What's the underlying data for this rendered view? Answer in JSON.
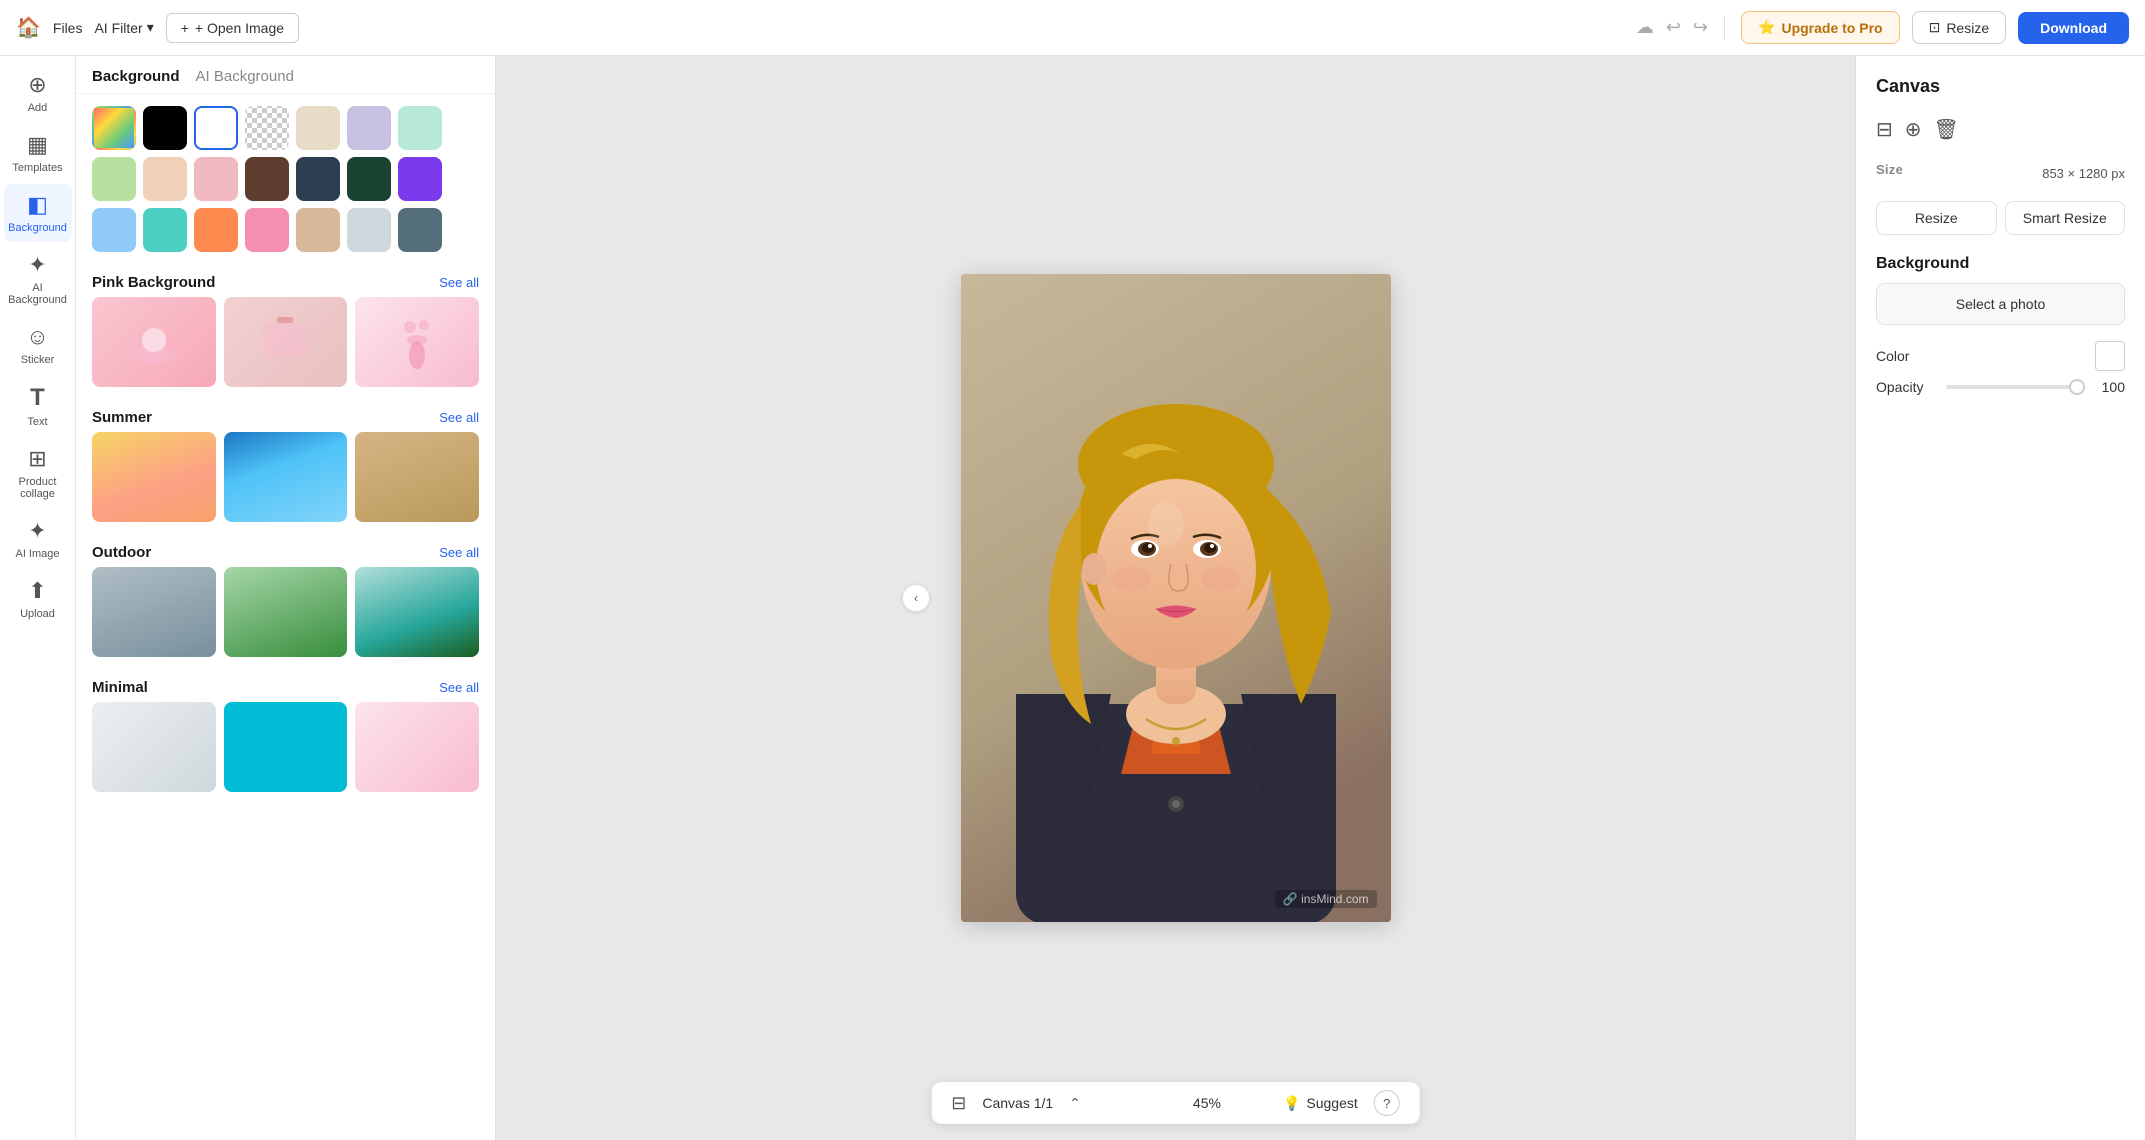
{
  "topbar": {
    "home_icon": "🏠",
    "files_label": "Files",
    "ai_filter_label": "AI Filter",
    "open_image_label": "+ Open Image",
    "cloud_icon": "☁",
    "undo_icon": "↩",
    "redo_icon": "↪",
    "upgrade_label": "Upgrade to Pro",
    "upgrade_icon": "⭐",
    "resize_label": "Resize",
    "resize_icon": "⊡",
    "download_label": "Download"
  },
  "sidebar": {
    "items": [
      {
        "id": "add",
        "icon": "＋",
        "label": "Add"
      },
      {
        "id": "templates",
        "icon": "▦",
        "label": "Templates"
      },
      {
        "id": "background",
        "icon": "◧",
        "label": "Background",
        "active": true
      },
      {
        "id": "ai-background",
        "icon": "✦",
        "label": "AI Background"
      },
      {
        "id": "sticker",
        "icon": "☺",
        "label": "Sticker"
      },
      {
        "id": "text",
        "icon": "T",
        "label": "Text"
      },
      {
        "id": "product-collage",
        "icon": "⊞",
        "label": "Product collage"
      },
      {
        "id": "ai-image",
        "icon": "✦",
        "label": "AI Image"
      },
      {
        "id": "upload",
        "icon": "⬆",
        "label": "Upload"
      }
    ]
  },
  "panel": {
    "tab_background": "Background",
    "tab_ai_background": "AI Background",
    "colors": [
      {
        "id": "gradient",
        "type": "gradient",
        "label": "Gradient"
      },
      {
        "id": "black",
        "color": "#000000",
        "label": "Black"
      },
      {
        "id": "white",
        "color": "#ffffff",
        "label": "White",
        "selected": true
      },
      {
        "id": "transparent",
        "type": "transparent",
        "label": "Transparent"
      },
      {
        "id": "beige",
        "color": "#e8dcc8",
        "label": "Beige"
      },
      {
        "id": "lavender",
        "color": "#c8c0e0",
        "label": "Lavender"
      },
      {
        "id": "mint",
        "color": "#b8e8d8",
        "label": "Mint"
      },
      {
        "id": "light-green",
        "color": "#b8e0a0",
        "label": "Light Green"
      },
      {
        "id": "peach",
        "color": "#f0d0b8",
        "label": "Peach"
      },
      {
        "id": "pink",
        "color": "#f0b8c0",
        "label": "Pink"
      },
      {
        "id": "brown",
        "color": "#5c3d2e",
        "label": "Brown"
      },
      {
        "id": "navy",
        "color": "#2c3e50",
        "label": "Navy"
      },
      {
        "id": "dark-green",
        "color": "#1b4332",
        "label": "Dark Green"
      },
      {
        "id": "purple",
        "color": "#7c3aed",
        "label": "Purple"
      },
      {
        "id": "sky-blue",
        "color": "#90caf9",
        "label": "Sky Blue"
      },
      {
        "id": "teal",
        "color": "#4dd0c4",
        "label": "Teal"
      },
      {
        "id": "orange",
        "color": "#ff8a50",
        "label": "Orange"
      },
      {
        "id": "salmon",
        "color": "#f48fb1",
        "label": "Salmon"
      },
      {
        "id": "tan",
        "color": "#d7b899",
        "label": "Tan"
      },
      {
        "id": "light-gray",
        "color": "#cfd8dc",
        "label": "Light Gray"
      },
      {
        "id": "dark-gray",
        "color": "#546e7a",
        "label": "Dark Gray"
      }
    ],
    "sections": [
      {
        "id": "pink-background",
        "title": "Pink Background",
        "see_all": "See all"
      },
      {
        "id": "summer",
        "title": "Summer",
        "see_all": "See all"
      },
      {
        "id": "outdoor",
        "title": "Outdoor",
        "see_all": "See all"
      },
      {
        "id": "minimal",
        "title": "Minimal",
        "see_all": "See all"
      }
    ]
  },
  "canvas": {
    "label": "Canvas 1/1",
    "zoom": "45%",
    "watermark": "🔗 insMind.com",
    "expand_icon": "⌃",
    "suggest_label": "Suggest",
    "suggest_icon": "💡",
    "help_label": "?"
  },
  "right_panel": {
    "title": "Canvas",
    "actions": [
      {
        "id": "layers",
        "icon": "⊟"
      },
      {
        "id": "duplicate",
        "icon": "⊕"
      },
      {
        "id": "delete",
        "icon": "🗑"
      }
    ],
    "size_section": "Size",
    "size_value": "853 × 1280 px",
    "resize_btn": "Resize",
    "smart_resize_btn": "Smart Resize",
    "background_section": "Background",
    "select_photo_btn": "Select a photo",
    "color_label": "Color",
    "opacity_label": "Opacity",
    "opacity_value": "100"
  }
}
